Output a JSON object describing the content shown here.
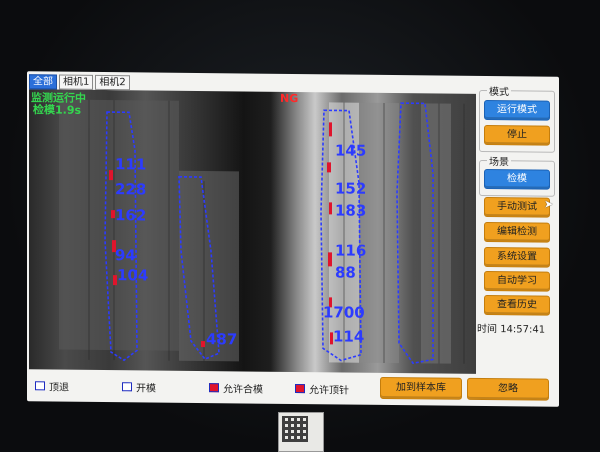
{
  "tabs": [
    {
      "label": "全部",
      "active": true
    },
    {
      "label": "相机1",
      "active": false
    },
    {
      "label": "相机2",
      "active": false
    }
  ],
  "camera": {
    "status_line1": "监测运行中",
    "status_line2": "检模1.9s",
    "verdict": "NG",
    "verdict_color": "#ff2a2a",
    "left_mold_numbers": [
      "111",
      "228",
      "162",
      "94",
      "104"
    ],
    "left_bottom_number": "487",
    "right_mold_numbers": [
      "145",
      "152",
      "183",
      "116",
      "88",
      "1700",
      "114"
    ]
  },
  "panel": {
    "mode_label": "模式",
    "run_mode_button": "运行模式",
    "stop_button": "停止",
    "scene_label": "场景",
    "inspect_button": "检模",
    "manual_test_button": "手动测试",
    "edit_detect_button": "编辑检测",
    "settings_button": "系统设置",
    "auto_learn_button": "自动学习",
    "history_button": "查看历史",
    "clock_label": "时间",
    "clock_value": "14:57:41"
  },
  "legend": [
    {
      "label": "顶退",
      "style": "outline"
    },
    {
      "label": "开模",
      "style": "outline"
    },
    {
      "label": "允许合模",
      "style": "filled"
    },
    {
      "label": "允许顶针",
      "style": "filled"
    }
  ],
  "bottom_buttons": {
    "add_sample": "加到样本库",
    "ignore": "忽略"
  },
  "colors": {
    "accent_blue": "#2e83e0",
    "accent_orange": "#f0a01f",
    "roi_blue": "#2c3bff",
    "status_green": "#34d64f",
    "defect_red": "#e0142c"
  }
}
